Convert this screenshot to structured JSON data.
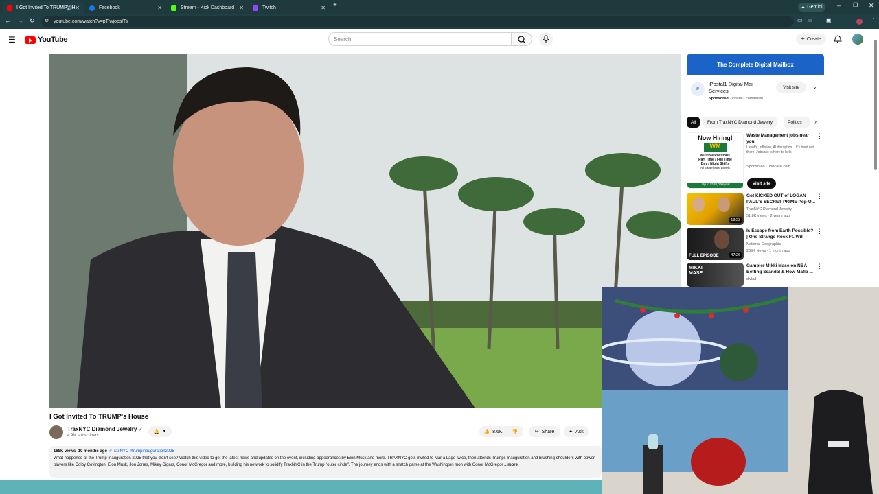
{
  "browser": {
    "tabs": [
      {
        "label": "I Got Invited To TRUMP's H",
        "icon": "youtube-icon",
        "color": "#ff0000"
      },
      {
        "label": "Facebook",
        "icon": "facebook-icon",
        "color": "#1877f2"
      },
      {
        "label": "Stream - Kick Dashboard",
        "icon": "kick-icon",
        "color": "#53fc18"
      },
      {
        "label": "Twitch",
        "icon": "twitch-icon",
        "color": "#9146ff"
      }
    ],
    "gemini_label": "Gemini",
    "url": "youtube.com/watch?v=pTlwjopslTs"
  },
  "youtube": {
    "logo": "YouTube",
    "search_placeholder": "Search",
    "create_label": "Create",
    "video": {
      "title": "I Got Invited To TRUMP's House",
      "channel": "TraxNYC Diamond Jewelry",
      "subscribers": "4.9M subscribers",
      "likes": "8.6K",
      "share_label": "Share",
      "ask_label": "Ask",
      "views": "168K views",
      "age": "10 months ago",
      "tags": "#TraxNYC #trumpinauguration2025",
      "description": "What happened at the Trump Inauguration 2025 that you didn't see? Watch this video to get the latest news and updates on the event, including appearances by Elon Musk and more. TRAXNYC gets invited to Mar a Lago twice, then attends Trumps Inauguration and brushing shoulders with power players like Colby Covington, Elon Musk, Jon Jones, Mikey Cigars, Conor McGregor and more, building his network to solidify TraxNYC in the Trump \"outer circle\". The journey ends with a snatch game at the Washington mon with Conor McGregor",
      "more_label": "...more"
    },
    "ad": {
      "banner": "The Complete Digital Mailbox",
      "title": "iPostal1 Digital Mail Services",
      "sponsored": "Sponsored",
      "domain": "· ipostal1.com/busin...",
      "cta": "Visit site"
    },
    "chips": [
      "All",
      "From TraxNYC Diamond Jewelry",
      "Politics"
    ],
    "recs": [
      {
        "title": "Waste Management jobs near you",
        "sub1": "Layoffs, inflation, AI disruption... It's hard out there. Jobcase is here to help.",
        "sub2": "Sponsored · Jobcase.com",
        "cta": "Visit site",
        "thumb_text": "Now Hiring!",
        "thumb_sub": "Multiple Positions",
        "thumb_sub2": "Part Time / Full Time",
        "thumb_sub3": "Day / Night Shifts",
        "thumb_sub4": "All Experience Levels",
        "thumb_pay": "Up to $120,000/year"
      },
      {
        "title": "Got KICKED OUT of LOGAN PAUL'S SECRET PRIME Pop-U...",
        "sub1": "TraxNYC Diamond Jewelry",
        "sub2": "51.8K views · 2 years ago",
        "dur": "13:23"
      },
      {
        "title": "Is Escape from Earth Possible? | One Strange Rock Ft. Will Smit...",
        "sub1": "National Geographic",
        "sub2": "269K views · 1 month ago",
        "dur": "47:26",
        "badge": "FULL EPISODE"
      },
      {
        "title": "Gambler Mikki Mase on NBA Betting Scandal & How Mafia ...",
        "sub1": "djvlad",
        "sub2": "",
        "dur": ""
      }
    ]
  }
}
